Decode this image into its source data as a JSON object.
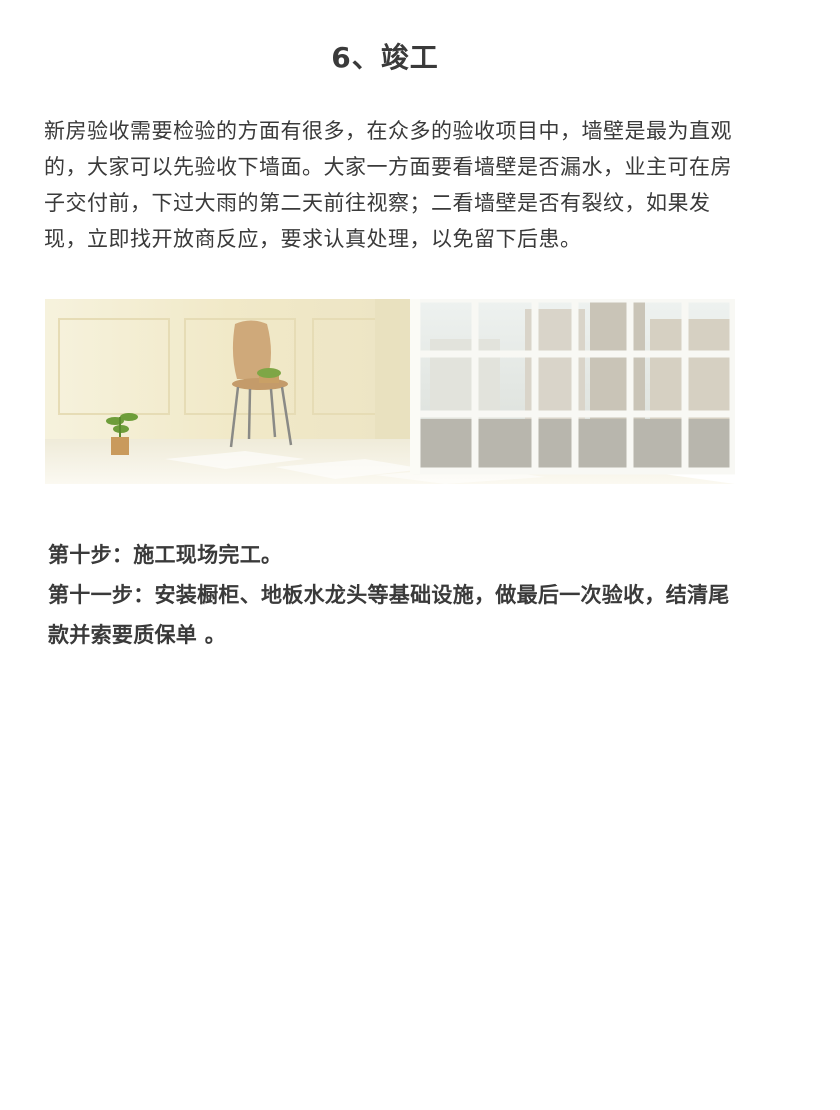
{
  "section": {
    "title": "6、竣工"
  },
  "intro": {
    "text": "新房验收需要检验的方面有很多，在众多的验收项目中，墙壁是最为直观的，大家可以先验收下墙面。大家一方面要看墙壁是否漏水，业主可在房子交付前，下过大雨的第二天前往视察；二看墙壁是否有裂纹，如果发现，立即找开放商反应，要求认真处理，以免留下后患。"
  },
  "steps": {
    "step10": "第十步：施工现场完工。",
    "step11": "第十一步：安装橱柜、地板水龙头等基础设施，做最后一次验收，结清尾款并索要质保单 。"
  },
  "colors": {
    "text": "#3a3a3a",
    "wall": "#f3edd2",
    "floor": "#f7f4ea"
  }
}
